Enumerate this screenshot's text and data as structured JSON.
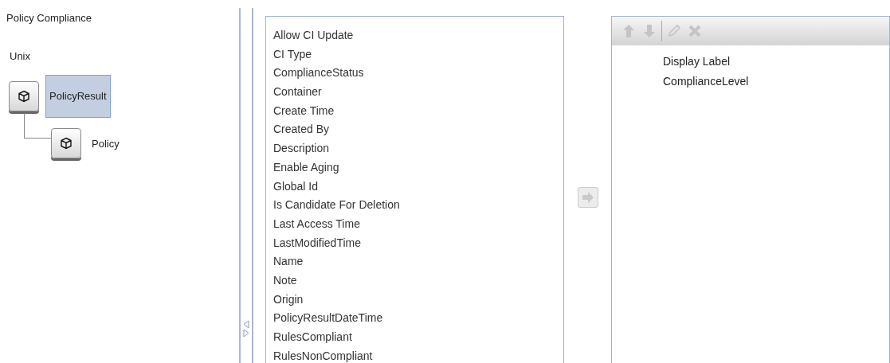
{
  "tree": {
    "title": "Policy Compliance",
    "group": "Unix",
    "nodes": [
      {
        "label": "PolicyResult",
        "selected": true,
        "children": [
          {
            "label": "Policy",
            "selected": false
          }
        ]
      }
    ]
  },
  "attributes": {
    "items": [
      "Allow CI Update",
      "CI Type",
      "ComplianceStatus",
      "Container",
      "Create Time",
      "Created By",
      "Description",
      "Enable Aging",
      "Global Id",
      "Is Candidate For Deletion",
      "Last Access Time",
      "LastModifiedTime",
      "Name",
      "Note",
      "Origin",
      "PolicyResultDateTime",
      "RulesCompliant",
      "RulesNonCompliant"
    ]
  },
  "move_button": {
    "disabled": true
  },
  "layout": {
    "toolbar": [
      {
        "kind": "up",
        "disabled": true
      },
      {
        "kind": "down",
        "disabled": true
      },
      {
        "kind": "edit",
        "disabled": true
      },
      {
        "kind": "delete",
        "disabled": true
      }
    ],
    "items": [
      "Display Label",
      "ComplianceLevel"
    ]
  }
}
